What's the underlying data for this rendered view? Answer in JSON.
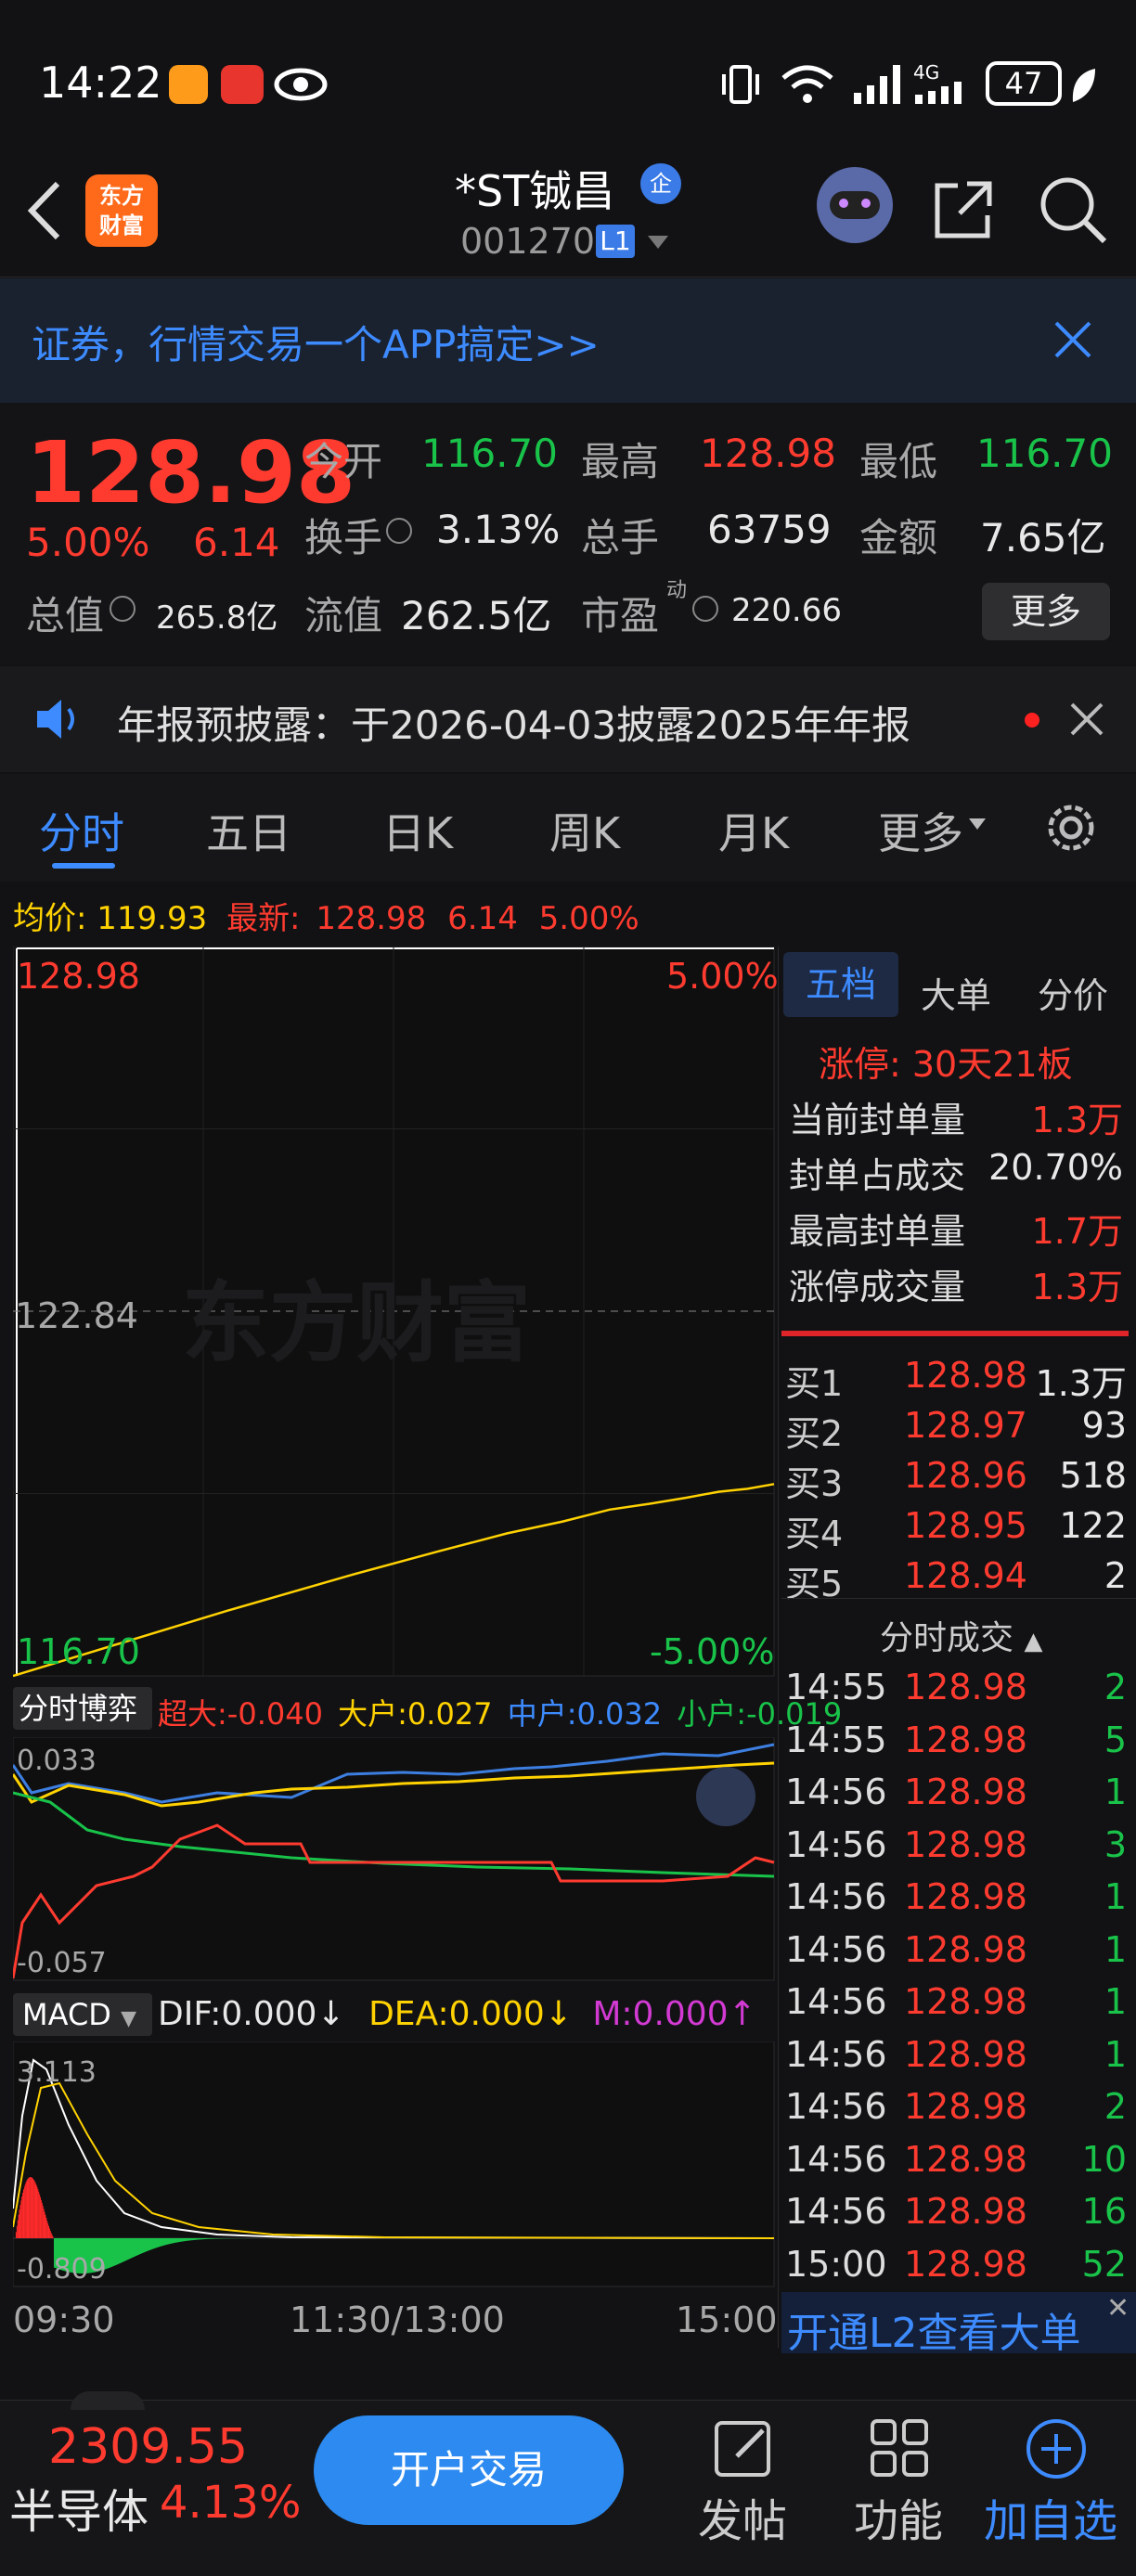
{
  "status_bar": {
    "time": "14:22",
    "battery": "47",
    "network": "4G"
  },
  "header": {
    "logo_line1": "东方",
    "logo_line2": "财富",
    "title": "*ST铖昌",
    "badge": "企",
    "code": "001270",
    "level": "L1"
  },
  "banner": {
    "text": "证券，行情交易一个APP搞定>>"
  },
  "quote": {
    "price": "128.98",
    "change_pct": "5.00%",
    "change": "6.14",
    "open_label": "今开",
    "open": "116.70",
    "high_label": "最高",
    "high": "128.98",
    "low_label": "最低",
    "low": "116.70",
    "turnover_label": "换手",
    "turnover": "3.13%",
    "volume_label": "总手",
    "volume": "63759",
    "amount_label": "金额",
    "amount": "7.65亿",
    "mktcap_label": "总值",
    "mktcap": "265.8亿",
    "float_label": "流值",
    "float": "262.5亿",
    "pe_label": "市盈",
    "pe_sup": "动",
    "pe": "220.66",
    "more_btn": "更多"
  },
  "notice": {
    "text": "年报预披露：于2026-04-03披露2025年年报"
  },
  "tabs": [
    "分时",
    "五日",
    "日K",
    "周K",
    "月K",
    "更多"
  ],
  "chart_header": {
    "avg_label": "均价:",
    "avg": "119.93",
    "last_label": "最新:",
    "last": "128.98",
    "chg": "6.14",
    "pct": "5.00%"
  },
  "chart_labels": {
    "top_price": "128.98",
    "top_pct": "5.00%",
    "mid_price": "122.84",
    "bottom_price": "116.70",
    "bottom_pct": "-5.00%",
    "watermark": "东方财富"
  },
  "flow": {
    "select": "分时博弈",
    "super_label": "超大:",
    "super": "-0.040",
    "large_label": "大户:",
    "large": "0.027",
    "mid_label": "中户:",
    "mid": "0.032",
    "small_label": "小户:",
    "small": "-0.019",
    "top": "0.033",
    "bottom": "-0.057"
  },
  "macd": {
    "select": "MACD",
    "dif": "DIF:0.000",
    "dea": "DEA:0.000",
    "m": "M:0.000",
    "top": "3.113",
    "bottom": "-0.809"
  },
  "time_axis": [
    "09:30",
    "11:30/13:00",
    "15:00"
  ],
  "side_tabs": [
    "五档",
    "大单",
    "分价"
  ],
  "limit": {
    "title": "涨停: 30天21板",
    "rows": [
      {
        "k": "当前封单量",
        "v": "1.3万"
      },
      {
        "k": "封单占成交",
        "v": "20.70%"
      },
      {
        "k": "最高封单量",
        "v": "1.7万"
      },
      {
        "k": "涨停成交量",
        "v": "1.3万"
      }
    ]
  },
  "bids": [
    {
      "k": "买1",
      "p": "128.98",
      "v": "1.3万"
    },
    {
      "k": "买2",
      "p": "128.97",
      "v": "93"
    },
    {
      "k": "买3",
      "p": "128.96",
      "v": "518"
    },
    {
      "k": "买4",
      "p": "128.95",
      "v": "122"
    },
    {
      "k": "买5",
      "p": "128.94",
      "v": "2"
    }
  ],
  "ticks_title": "分时成交",
  "ticks": [
    {
      "t": "14:55",
      "p": "128.98",
      "v": "2"
    },
    {
      "t": "14:55",
      "p": "128.98",
      "v": "5"
    },
    {
      "t": "14:56",
      "p": "128.98",
      "v": "1"
    },
    {
      "t": "14:56",
      "p": "128.98",
      "v": "3"
    },
    {
      "t": "14:56",
      "p": "128.98",
      "v": "1"
    },
    {
      "t": "14:56",
      "p": "128.98",
      "v": "1"
    },
    {
      "t": "14:56",
      "p": "128.98",
      "v": "1"
    },
    {
      "t": "14:56",
      "p": "128.98",
      "v": "1"
    },
    {
      "t": "14:56",
      "p": "128.98",
      "v": "2"
    },
    {
      "t": "14:56",
      "p": "128.98",
      "v": "10"
    },
    {
      "t": "14:56",
      "p": "128.98",
      "v": "16"
    },
    {
      "t": "15:00",
      "p": "128.98",
      "v": "52"
    }
  ],
  "l2_link": "开通L2查看大单",
  "bottom": {
    "index_value": "2309.55",
    "index_name": "半导体",
    "index_pct": "4.13%",
    "trade_btn": "开户交易",
    "post": "发帖",
    "func": "功能",
    "add": "加自选"
  },
  "colors": {
    "up": "#ff3b30",
    "down": "#19c34a",
    "avg": "#ffd200",
    "accent": "#3d8bff"
  },
  "chart_data": {
    "type": "line",
    "x_range": [
      "09:30",
      "15:00"
    ],
    "ylim": [
      116.7,
      128.98
    ],
    "prev_close": 122.84,
    "series": [
      {
        "name": "最新",
        "values": [
          116.7,
          128.98
        ]
      },
      {
        "name": "均价",
        "values": [
          116.7,
          117.8,
          118.4,
          118.8,
          119.1,
          119.3,
          119.5,
          119.6,
          119.7,
          119.8,
          119.85,
          119.93
        ]
      }
    ]
  }
}
